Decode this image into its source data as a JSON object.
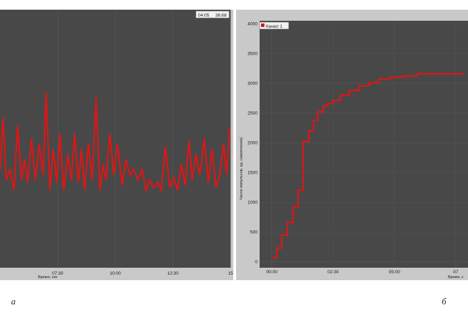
{
  "chart_data": [
    {
      "type": "line",
      "panel_label": "а",
      "status_time": "04:05",
      "status_value": "38.68",
      "xlabel": "Время, сек",
      "x_ticks": [
        "07:30",
        "10:00",
        "12:30",
        "15"
      ],
      "x_tick_values": [
        450,
        600,
        750,
        900
      ],
      "xlim": [
        300,
        900
      ],
      "ylim": [
        0,
        100
      ],
      "background": "#484848",
      "line_color": "#e01515",
      "series": [
        {
          "x": [
            300,
            308,
            316,
            326,
            336,
            346,
            356,
            364,
            372,
            382,
            392,
            402,
            412,
            420,
            430,
            438,
            448,
            456,
            466,
            476,
            486,
            494,
            504,
            512,
            520,
            530,
            540,
            550,
            560,
            568,
            576,
            586,
            596,
            606,
            618,
            628,
            638,
            648,
            658,
            670,
            680,
            690,
            700,
            710,
            720,
            730,
            742,
            752,
            762,
            772,
            782,
            792,
            800,
            810,
            820,
            832,
            842,
            852,
            862,
            872,
            882,
            890,
            898
          ],
          "y": [
            38,
            58,
            34,
            38,
            30,
            55,
            34,
            42,
            33,
            50,
            34,
            48,
            36,
            68,
            30,
            46,
            33,
            52,
            30,
            44,
            34,
            52,
            33,
            46,
            30,
            48,
            34,
            66,
            30,
            40,
            34,
            52,
            36,
            48,
            32,
            42,
            36,
            38,
            34,
            38,
            30,
            34,
            31,
            33,
            30,
            47,
            31,
            35,
            30,
            40,
            32,
            49,
            34,
            44,
            36,
            50,
            33,
            46,
            31,
            36,
            48,
            36,
            54
          ]
        }
      ]
    },
    {
      "type": "line",
      "panel_label": "б",
      "ylabel": "Число импульсов, ед. (накопление)",
      "xlabel": "Время, с",
      "legend": "Канал 1",
      "legend_position": "top-left",
      "y_ticks": [
        0,
        500,
        1000,
        1500,
        2000,
        2500,
        3000,
        3500,
        4000
      ],
      "x_ticks": [
        "00:00",
        "02:30",
        "05:00",
        "07"
      ],
      "x_tick_values": [
        0,
        150,
        300,
        450
      ],
      "xlim": [
        -30,
        480
      ],
      "ylim": [
        -100,
        4050
      ],
      "background": "#484848",
      "line_color": "#e01515",
      "series": [
        {
          "name": "Канал 1",
          "x": [
            2,
            12,
            24,
            38,
            52,
            64,
            76,
            90,
            102,
            112,
            126,
            136,
            150,
            168,
            190,
            214,
            238,
            262,
            290,
            320,
            356,
            400,
            440,
            470
          ],
          "y": [
            70,
            230,
            450,
            660,
            920,
            1200,
            2020,
            2200,
            2380,
            2520,
            2620,
            2660,
            2710,
            2800,
            2880,
            2960,
            3010,
            3070,
            3100,
            3120,
            3160,
            3160,
            3160,
            3160
          ]
        }
      ]
    }
  ]
}
